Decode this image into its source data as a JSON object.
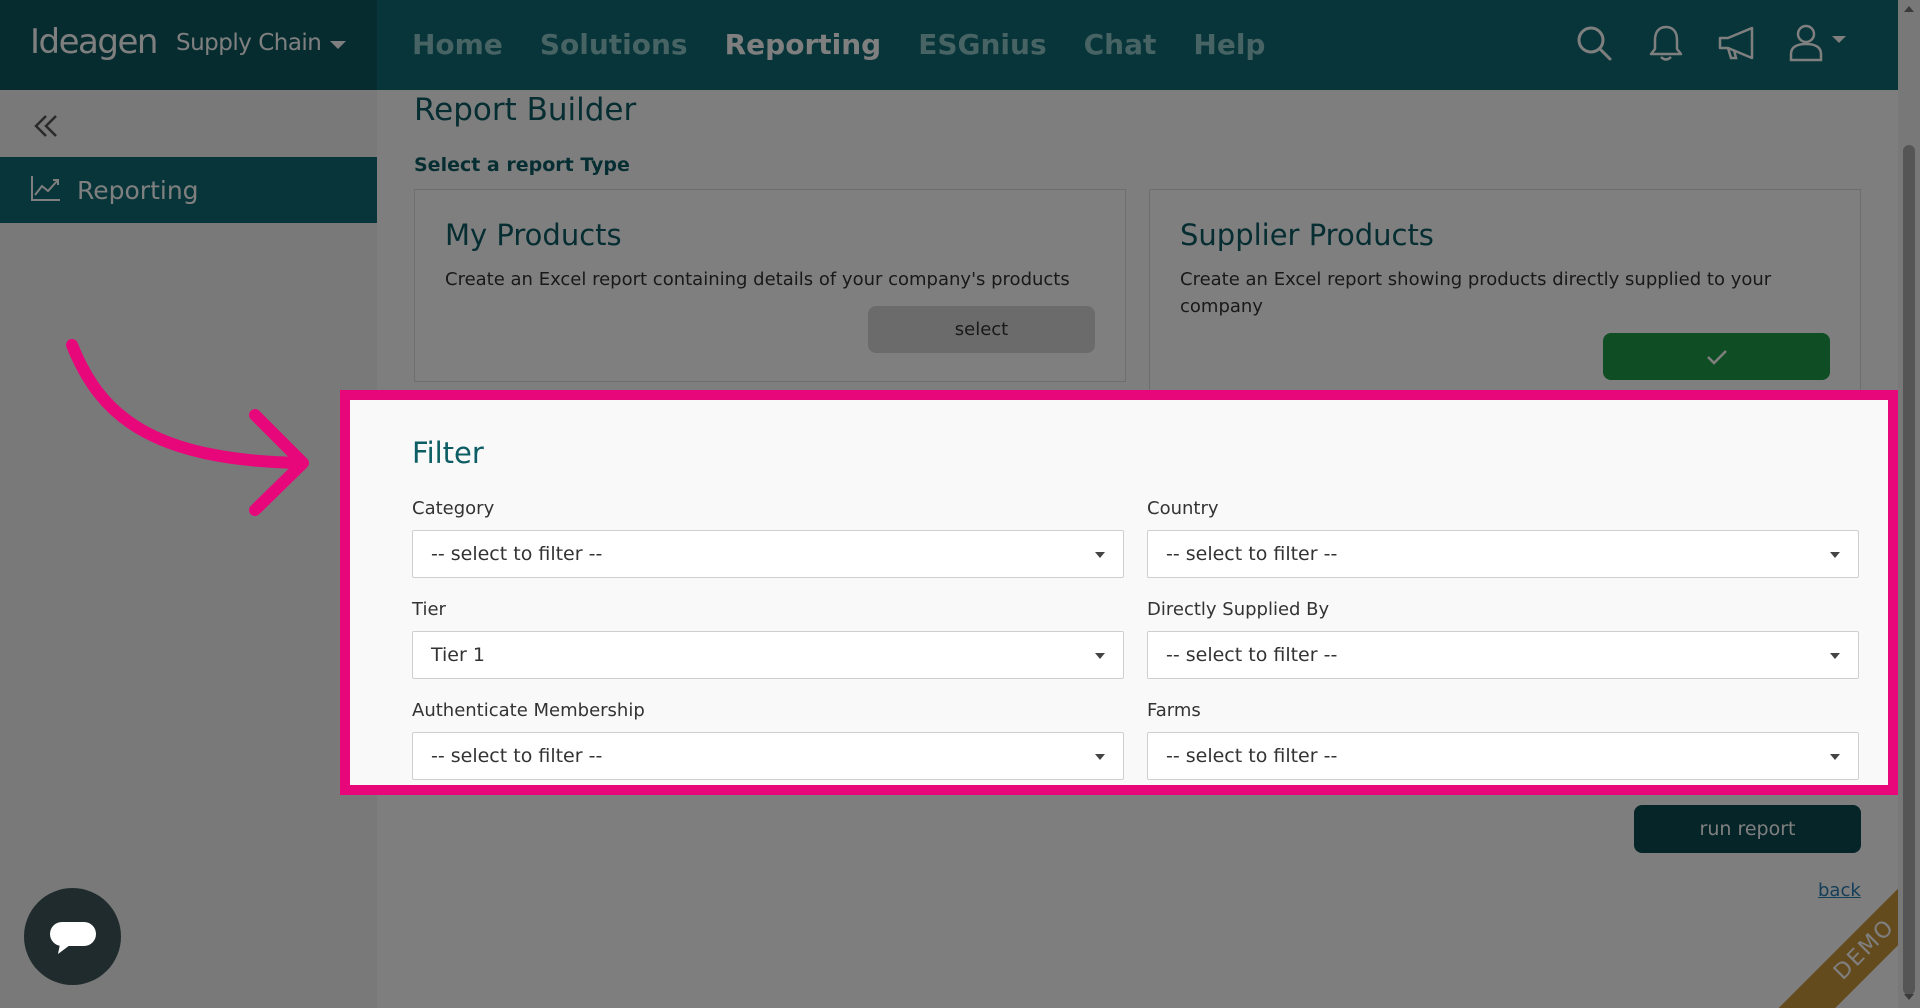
{
  "brand": {
    "logo": "Ideagen",
    "product": "Supply Chain"
  },
  "nav": {
    "items": [
      {
        "label": "Home",
        "active": false
      },
      {
        "label": "Solutions",
        "active": false
      },
      {
        "label": "Reporting",
        "active": true
      },
      {
        "label": "ESGnius",
        "active": false
      },
      {
        "label": "Chat",
        "active": false
      },
      {
        "label": "Help",
        "active": false
      }
    ]
  },
  "icons": {
    "search": "search-icon",
    "notifications": "bell-icon",
    "announcements": "megaphone-icon",
    "user": "user-icon"
  },
  "sidebar": {
    "items": [
      {
        "label": "Reporting",
        "icon": "chart-line-icon"
      }
    ]
  },
  "page": {
    "title": "Report Builder",
    "section_label": "Select a report Type",
    "cards": [
      {
        "title": "My Products",
        "description": "Create an Excel report containing details of your company's products",
        "button": "select"
      },
      {
        "title": "Supplier Products",
        "description_line1": "Create an Excel report showing products directly supplied to your",
        "description_line2": "company",
        "selected": true
      }
    ]
  },
  "filter": {
    "title": "Filter",
    "fields": [
      {
        "label": "Category",
        "value": "-- select to filter --"
      },
      {
        "label": "Country",
        "value": "-- select to filter --"
      },
      {
        "label": "Tier",
        "value": "Tier 1"
      },
      {
        "label": "Directly Supplied By",
        "value": "-- select to filter --"
      },
      {
        "label": "Authenticate Membership",
        "value": "-- select to filter --"
      },
      {
        "label": "Farms",
        "value": "-- select to filter --"
      }
    ]
  },
  "actions": {
    "run_report": "run report",
    "back": "back"
  },
  "badge": {
    "demo": "DEMO"
  },
  "colors": {
    "primary": "#0f6b72",
    "highlight": "#e8077b",
    "success": "#1e9a48",
    "run": "#0c4a50"
  }
}
